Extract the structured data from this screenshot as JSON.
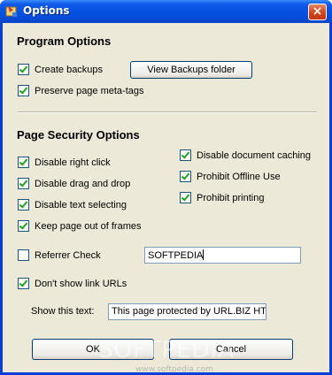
{
  "window": {
    "title": "Options",
    "close_label": "×"
  },
  "program_options": {
    "heading": "Program Options",
    "create_backups": {
      "label": "Create backups",
      "checked": true
    },
    "view_backups_button": "View Backups folder",
    "preserve_meta": {
      "label": "Preserve page meta-tags",
      "checked": true
    }
  },
  "security_options": {
    "heading": "Page Security Options",
    "left": [
      {
        "label": "Disable right click",
        "checked": true
      },
      {
        "label": "Disable drag and drop",
        "checked": true
      },
      {
        "label": "Disable text selecting",
        "checked": true
      },
      {
        "label": "Keep page out of frames",
        "checked": true
      }
    ],
    "right": [
      {
        "label": "Disable document caching",
        "checked": true
      },
      {
        "label": "Prohibit Offline Use",
        "checked": true
      },
      {
        "label": "Prohibit printing",
        "checked": true
      }
    ],
    "referrer_check": {
      "label": "Referrer Check",
      "checked": false,
      "value": "SOFTPEDIA"
    },
    "dont_show_urls": {
      "label": "Don't show link URLs",
      "checked": true
    },
    "show_text": {
      "label": "Show this text:",
      "value": "This page protected by URL.BIZ HT"
    }
  },
  "buttons": {
    "ok": "OK",
    "cancel": "Cancel"
  },
  "watermark": {
    "main": "SOFTPEDIA",
    "sub": "www.softpedia.com"
  }
}
